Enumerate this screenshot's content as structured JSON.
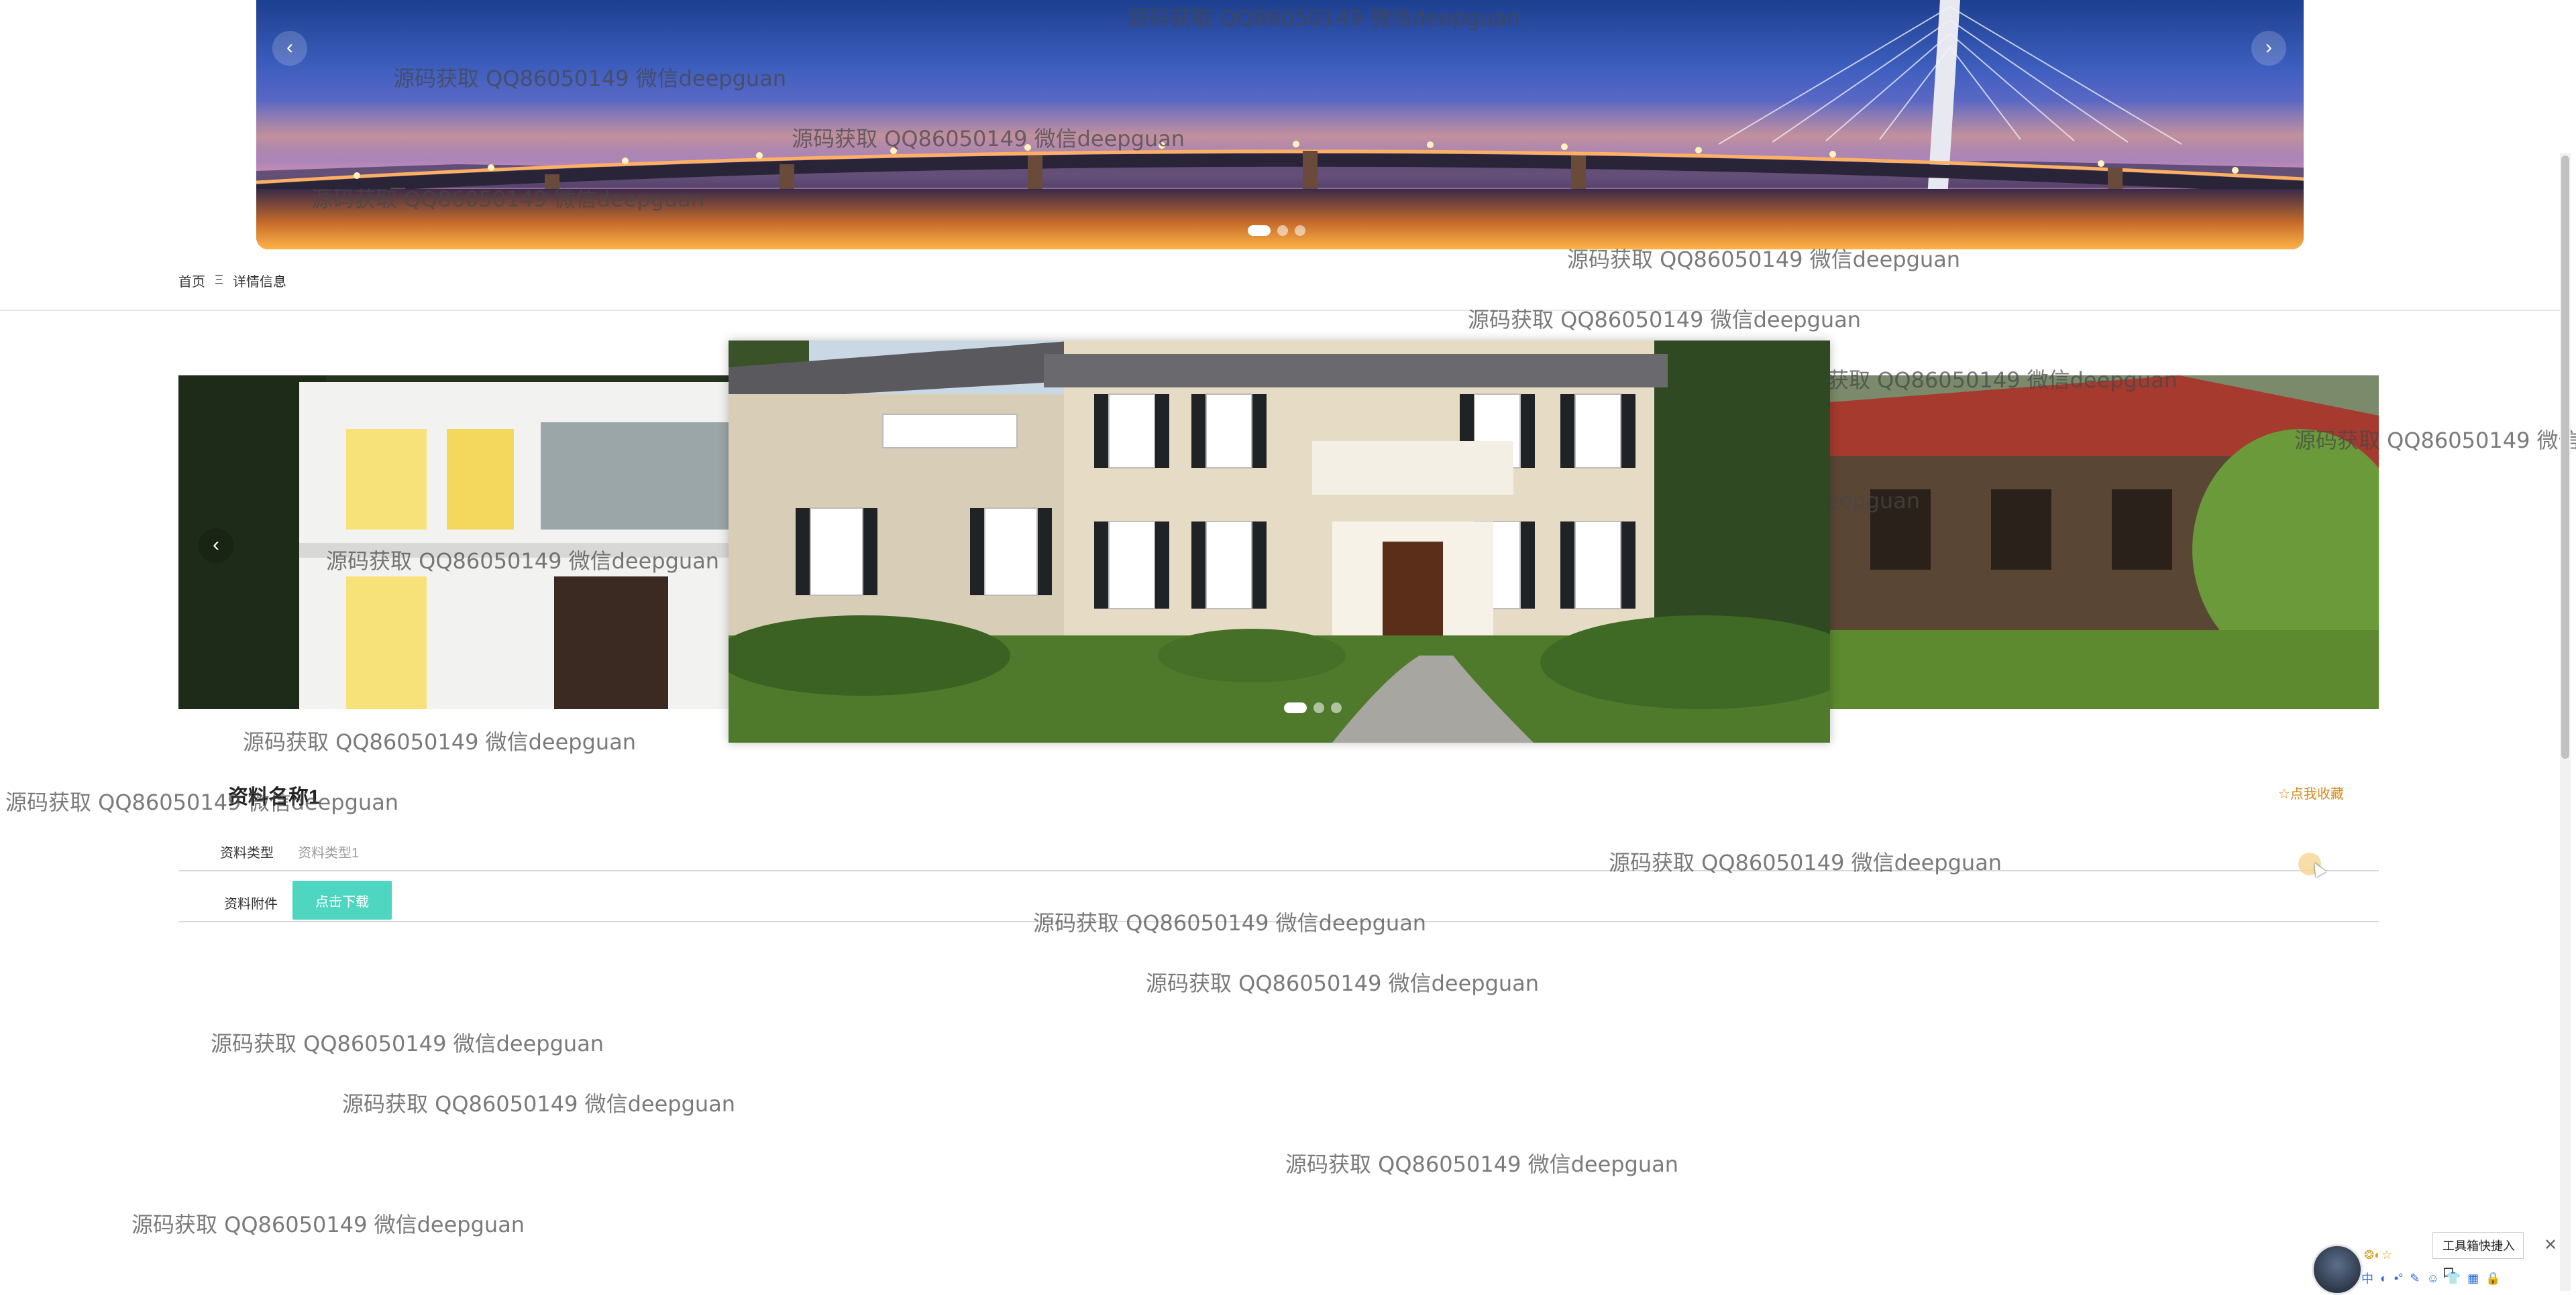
{
  "banner": {
    "prev_icon": "‹",
    "next_icon": "›",
    "slides": 3,
    "active_slide": 1
  },
  "breadcrumb": {
    "home": "首页",
    "separator": "Ξ",
    "current": "详情信息"
  },
  "gallery": {
    "prev_icon": "‹",
    "slides": 3,
    "active_slide": 1
  },
  "detail": {
    "title": "资料名称1",
    "favorite": "☆点我收藏",
    "type_label": "资料类型",
    "type_value": "资料类型1",
    "attachment_label": "资料附件",
    "download_button": "点击下载"
  },
  "watermark": {
    "text": "源码获取 QQ86050149 微信deepguan",
    "short_text": "源码获取 QQ86050149 微信de"
  },
  "widgets": {
    "toolbox_label": "工具箱快捷入口",
    "toolbox_close": "✕",
    "ime_items": [
      "中",
      "◐",
      "•°",
      "✎",
      "☺",
      "👕",
      "▦",
      "🔒"
    ],
    "mini_icons": "❂◐☆"
  },
  "colors": {
    "accent": "#4fd6c0",
    "favorite": "#d48a1c"
  }
}
